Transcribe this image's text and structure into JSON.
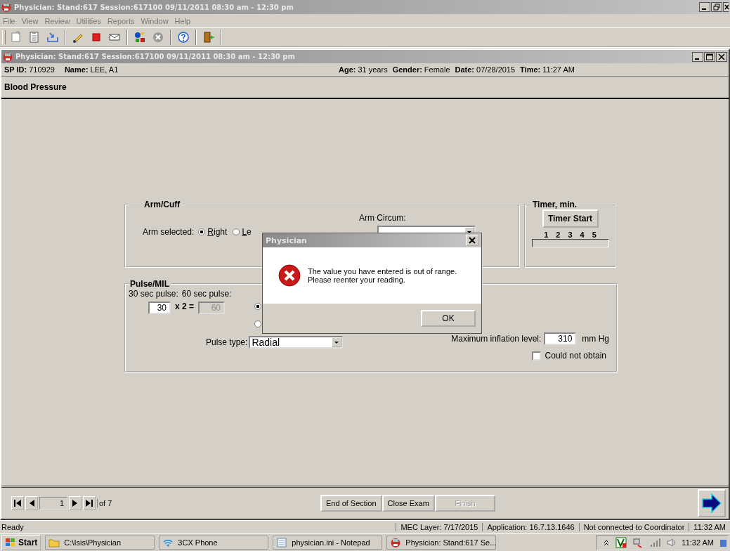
{
  "app_window": {
    "title": "Physician: Stand:617 Session:617100 09/11/2011 08:30 am - 12:30 pm"
  },
  "menu": [
    {
      "label": "File"
    },
    {
      "label": "View"
    },
    {
      "label": "Review"
    },
    {
      "label": "Utilities"
    },
    {
      "label": "Reports"
    },
    {
      "label": "Window"
    },
    {
      "label": "Help"
    }
  ],
  "exam_window": {
    "title": "Physician: Stand:617 Session:617100 09/11/2011 08:30 am - 12:30 pm"
  },
  "patient_left": [
    {
      "label": "SP ID:",
      "value": "710929"
    },
    {
      "label": "Name:",
      "value": "LEE, A1"
    }
  ],
  "patient_right": [
    {
      "label": "Age:",
      "value": "31 years"
    },
    {
      "label": "Gender:",
      "value": "Female"
    },
    {
      "label": "Date:",
      "value": "07/28/2015"
    },
    {
      "label": "Time:",
      "value": "11:27 AM"
    }
  ],
  "section_title": "Blood Pressure",
  "arm_cuff": {
    "legend": "Arm/Cuff",
    "arm_label": "Arm selected:",
    "circum_label": "Arm Circum:",
    "options": [
      {
        "label": "Right",
        "selected": true
      },
      {
        "label": "Le",
        "selected": false
      }
    ]
  },
  "timer": {
    "legend": "Timer, min.",
    "button": "Timer Start",
    "ticks": [
      "1",
      "2",
      "3",
      "4",
      "5"
    ]
  },
  "pulse_mil": {
    "legend": "Pulse/MIL",
    "label_30": "30 sec pulse:",
    "label_60": "60 sec pulse:",
    "pulse_30": "30",
    "multiplier": "x 2 =",
    "pulse_60": "60",
    "pulse_60_disabled": true,
    "options": [
      {
        "selected": true
      },
      {
        "selected": false
      }
    ],
    "pulse_type_label": "Pulse type:",
    "pulse_type": "Radial",
    "mil_label": "Maximum inflation level:",
    "mil_value": "310",
    "mil_unit": "mm Hg",
    "could_not_obtain": {
      "label": "Could not obtain",
      "checked": false
    }
  },
  "dialog": {
    "title": "Physician",
    "message": [
      "The value you have entered is out of range.",
      "Please reenter your reading."
    ],
    "button": "OK"
  },
  "navigator": {
    "page": "1",
    "of": "of 7"
  },
  "buttons": [
    {
      "label": "End of Section",
      "disabled": false
    },
    {
      "label": "Close Exam",
      "disabled": false
    },
    {
      "label": "Finish",
      "disabled": true
    }
  ],
  "status_bar": [
    "Ready",
    "MEC Layer: 7/17/2015",
    "Application: 16.7.13.1646",
    "Not connected to Coordinator",
    "11:32 AM"
  ],
  "taskbar": {
    "start": "Start",
    "items": [
      {
        "label": "C:\\Isis\\Physician",
        "kind": "folder"
      },
      {
        "label": "3CX Phone",
        "kind": "wifi"
      },
      {
        "label": "physician.ini - Notepad",
        "kind": "notepad"
      },
      {
        "label": "Physician: Stand:617 Se...",
        "kind": "app"
      }
    ],
    "clock": "11:32 AM"
  }
}
